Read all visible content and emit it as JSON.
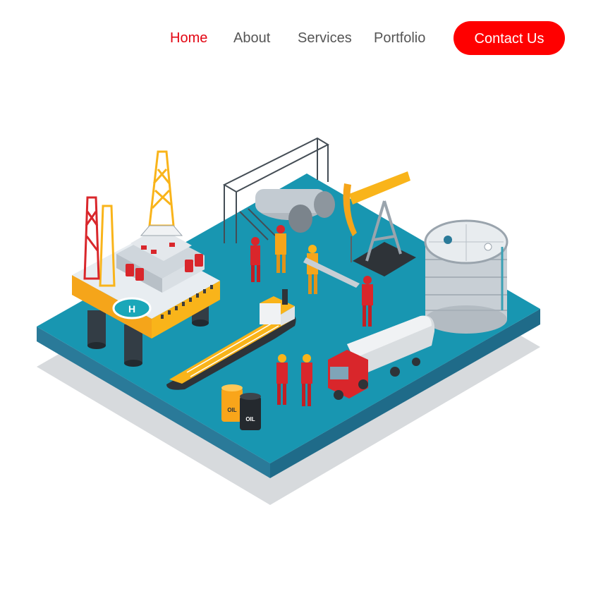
{
  "nav": {
    "items": [
      {
        "label": "Home",
        "active": true
      },
      {
        "label": "About",
        "active": false
      },
      {
        "label": "Services",
        "active": false
      },
      {
        "label": "Portfolio",
        "active": false
      }
    ],
    "cta_label": "Contact Us"
  },
  "illustration": {
    "barrel_label_1": "OIL",
    "barrel_label_2": "OIL",
    "helipad_letter": "H"
  },
  "colors": {
    "accent": "#ff0000",
    "active_link": "#e30613",
    "link": "#555555",
    "platform_top": "#1b8fa8",
    "platform_side": "#2a7a99",
    "shadow": "#d7dadd",
    "yellow": "#f9b41a",
    "red": "#d9262b"
  }
}
